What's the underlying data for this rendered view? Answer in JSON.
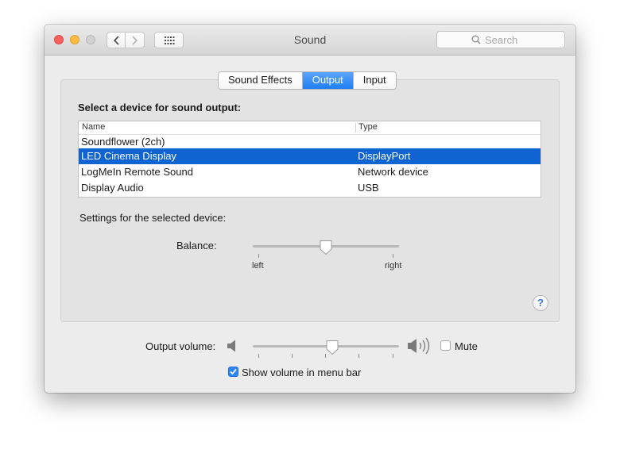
{
  "window": {
    "title": "Sound",
    "search_placeholder": "Search"
  },
  "tabs": [
    {
      "label": "Sound Effects",
      "active": false
    },
    {
      "label": "Output",
      "active": true
    },
    {
      "label": "Input",
      "active": false
    }
  ],
  "output": {
    "section_label": "Select a device for sound output:",
    "columns": {
      "name": "Name",
      "type": "Type"
    },
    "devices": [
      {
        "name": "Soundflower (2ch)",
        "type": "",
        "selected": false
      },
      {
        "name": "LED Cinema Display",
        "type": "DisplayPort",
        "selected": true
      },
      {
        "name": "LogMeIn Remote Sound",
        "type": "Network device",
        "selected": false
      },
      {
        "name": "Display Audio",
        "type": "USB",
        "selected": false
      }
    ],
    "settings_label": "Settings for the selected device:",
    "balance": {
      "label": "Balance:",
      "left_label": "left",
      "right_label": "right",
      "value": 0.5
    },
    "help_label": "?"
  },
  "volume": {
    "label": "Output volume:",
    "value": 0.55,
    "mute_label": "Mute",
    "mute_checked": false,
    "show_in_menu_label": "Show volume in menu bar",
    "show_in_menu_checked": true
  },
  "colors": {
    "accent": "#1f7ef5",
    "selection": "#0f64d2",
    "close": "#fc605c",
    "minimize": "#fdbc40"
  },
  "icons": {
    "back": "chevron-left-icon",
    "forward": "chevron-right-icon",
    "grid": "grid-icon",
    "search": "search-icon",
    "volume_low": "speaker-low-icon",
    "volume_high": "speaker-high-icon"
  }
}
